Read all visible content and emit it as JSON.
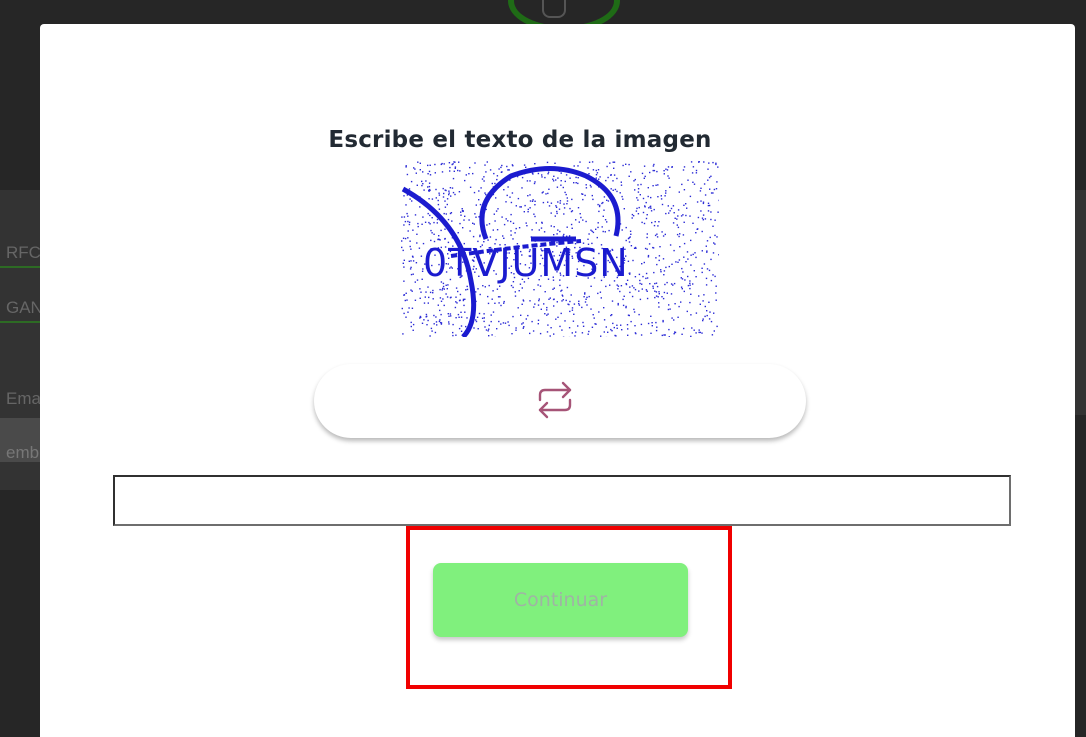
{
  "background": {
    "labels": [
      "RFC",
      "GAN",
      "Ema",
      "emb"
    ]
  },
  "modal": {
    "title": "Escribe el texto de la imagen",
    "captcha": {
      "text": "0TVJUMSN",
      "alt": "captcha-image"
    },
    "refresh_icon": "refresh-arrows-icon",
    "input": {
      "value": "",
      "placeholder": ""
    },
    "continue_label": "Continuar"
  },
  "colors": {
    "continue_bg": "#80f07d",
    "continue_text": "#9fb4a4",
    "highlight": "#f00000",
    "captcha_ink": "#1b1bcf",
    "refresh_icon": "#a65477"
  }
}
